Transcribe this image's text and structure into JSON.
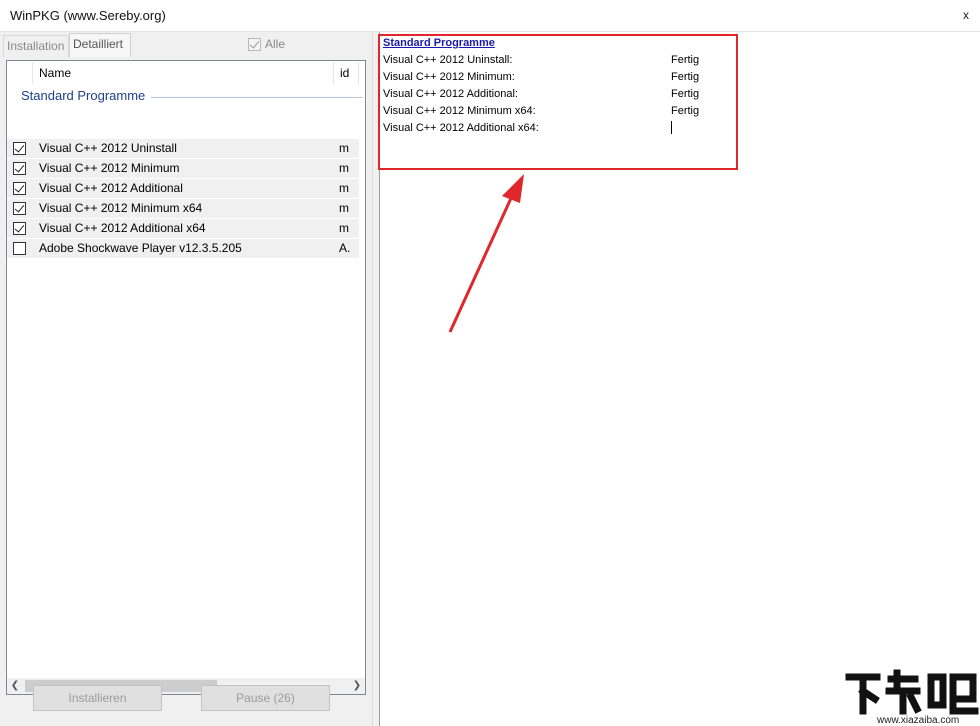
{
  "window": {
    "title": "WinPKG (www.Sereby.org)",
    "close_glyph": "x"
  },
  "tabs": [
    {
      "label": "Installation",
      "active": false
    },
    {
      "label": "Detailliert",
      "active": true
    }
  ],
  "alle": {
    "label": "Alle",
    "checked": true,
    "enabled": false
  },
  "list": {
    "columns": [
      "Name",
      "id"
    ],
    "group": "Standard Programme",
    "rows": [
      {
        "name": "Visual C++ 2012 Uninstall",
        "id": "m",
        "checked": true
      },
      {
        "name": "Visual C++ 2012 Minimum",
        "id": "m",
        "checked": true
      },
      {
        "name": "Visual C++ 2012 Additional",
        "id": "m",
        "checked": true
      },
      {
        "name": "Visual C++ 2012 Minimum x64",
        "id": "m",
        "checked": true
      },
      {
        "name": "Visual C++ 2012 Additional x64",
        "id": "m",
        "checked": true
      },
      {
        "name": "Adobe Shockwave Player v12.3.5.205",
        "id": "A.",
        "checked": false
      }
    ]
  },
  "buttons": {
    "install": "Installieren",
    "pause": "Pause (26)"
  },
  "status": {
    "title": "Standard Programme",
    "entries": [
      {
        "label": "Visual C++ 2012 Uninstall:",
        "value": "Fertig"
      },
      {
        "label": "Visual C++ 2012 Minimum:",
        "value": "Fertig"
      },
      {
        "label": "Visual C++ 2012 Additional:",
        "value": "Fertig"
      },
      {
        "label": "Visual C++ 2012 Minimum x64:",
        "value": "Fertig"
      },
      {
        "label": "Visual C++ 2012 Additional x64:",
        "value": ""
      }
    ]
  },
  "colors": {
    "annotation_red": "#e0282c",
    "group_blue": "#1e3f8c",
    "link_blue": "#1a1aaa"
  },
  "watermark": {
    "logo_text": "下载吧",
    "url": "www.xiazaiba.com"
  }
}
